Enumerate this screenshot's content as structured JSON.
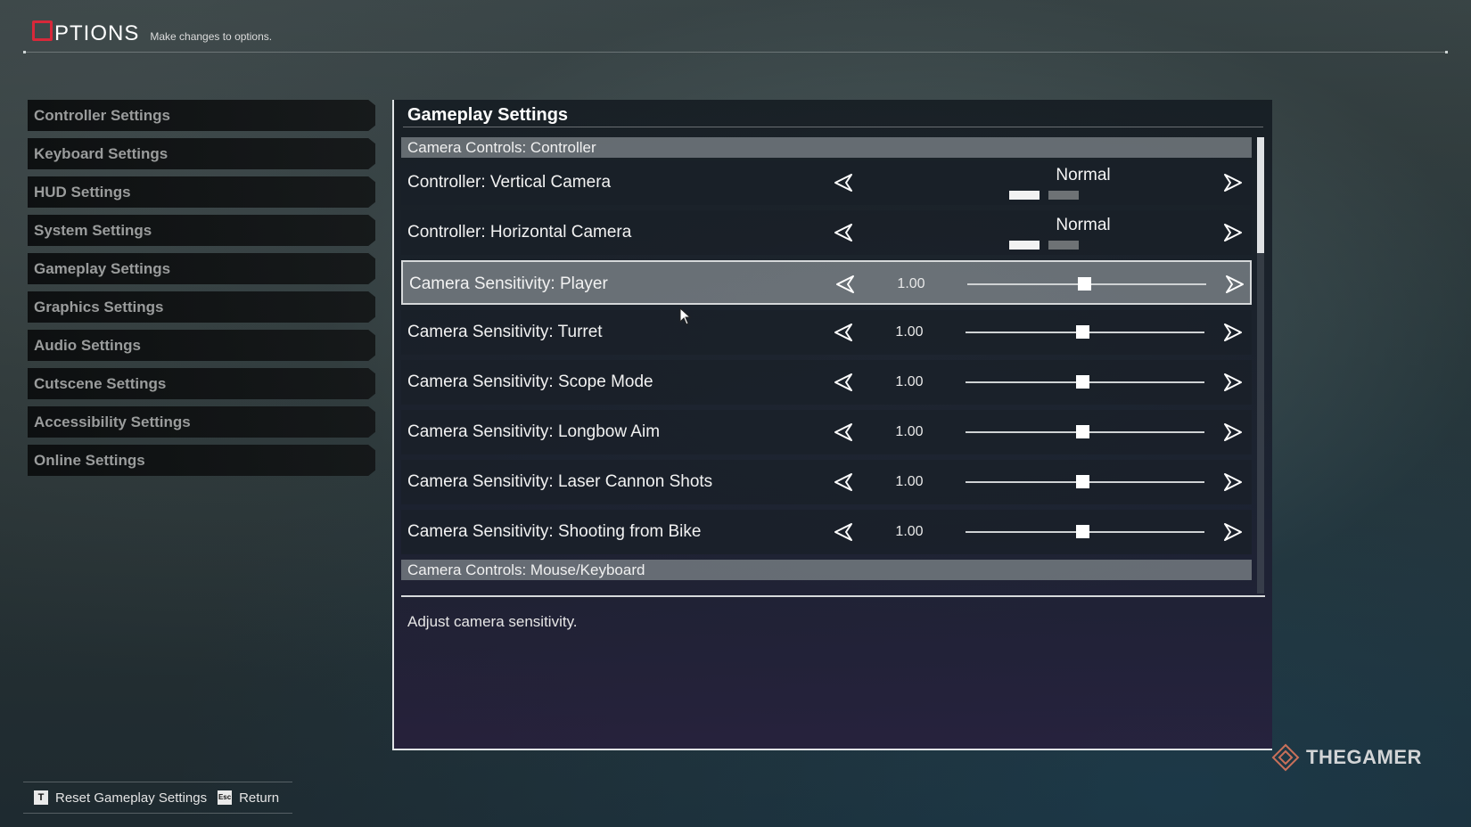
{
  "header": {
    "title_first_letter": "O",
    "title_rest": "PTIONS",
    "subtitle": "Make changes to options."
  },
  "sidebar": {
    "items": [
      {
        "label": "Controller Settings"
      },
      {
        "label": "Keyboard Settings"
      },
      {
        "label": "HUD Settings"
      },
      {
        "label": "System Settings"
      },
      {
        "label": "Gameplay Settings"
      },
      {
        "label": "Graphics Settings"
      },
      {
        "label": "Audio Settings"
      },
      {
        "label": "Cutscene Settings"
      },
      {
        "label": "Accessibility Settings"
      },
      {
        "label": "Online Settings"
      }
    ]
  },
  "panel": {
    "title": "Gameplay Settings",
    "section_controller": "Camera Controls: Controller",
    "section_mouse": "Camera Controls: Mouse/Keyboard",
    "rows": [
      {
        "label": "Controller: Vertical Camera",
        "option": "Normal",
        "type": "toggle"
      },
      {
        "label": "Controller: Horizontal Camera",
        "option": "Normal",
        "type": "toggle"
      },
      {
        "label": "Camera Sensitivity: Player",
        "value": "1.00",
        "level": 0.49,
        "type": "slider",
        "selected": true
      },
      {
        "label": "Camera Sensitivity: Turret",
        "value": "1.00",
        "level": 0.49,
        "type": "slider"
      },
      {
        "label": "Camera Sensitivity: Scope Mode",
        "value": "1.00",
        "level": 0.49,
        "type": "slider"
      },
      {
        "label": "Camera Sensitivity: Longbow Aim",
        "value": "1.00",
        "level": 0.49,
        "type": "slider"
      },
      {
        "label": "Camera Sensitivity: Laser Cannon Shots",
        "value": "1.00",
        "level": 0.49,
        "type": "slider"
      },
      {
        "label": "Camera Sensitivity: Shooting from Bike",
        "value": "1.00",
        "level": 0.49,
        "type": "slider"
      }
    ],
    "description": "Adjust camera sensitivity."
  },
  "footer": {
    "reset_key": "T",
    "reset_label": "Reset Gameplay Settings",
    "return_key": "Esc",
    "return_label": "Return"
  },
  "watermark": {
    "text": "THEGAMER"
  },
  "colors": {
    "accent": "#d8283a",
    "selected_row": "#aab0b4",
    "section_bar": "#787f84"
  },
  "icons": {
    "left_arrow": "arrow-left-icon",
    "right_arrow": "arrow-right-icon",
    "logo": "options-logo-icon",
    "watermark_logo": "thegamer-logo-icon",
    "cursor": "mouse-cursor-icon"
  }
}
